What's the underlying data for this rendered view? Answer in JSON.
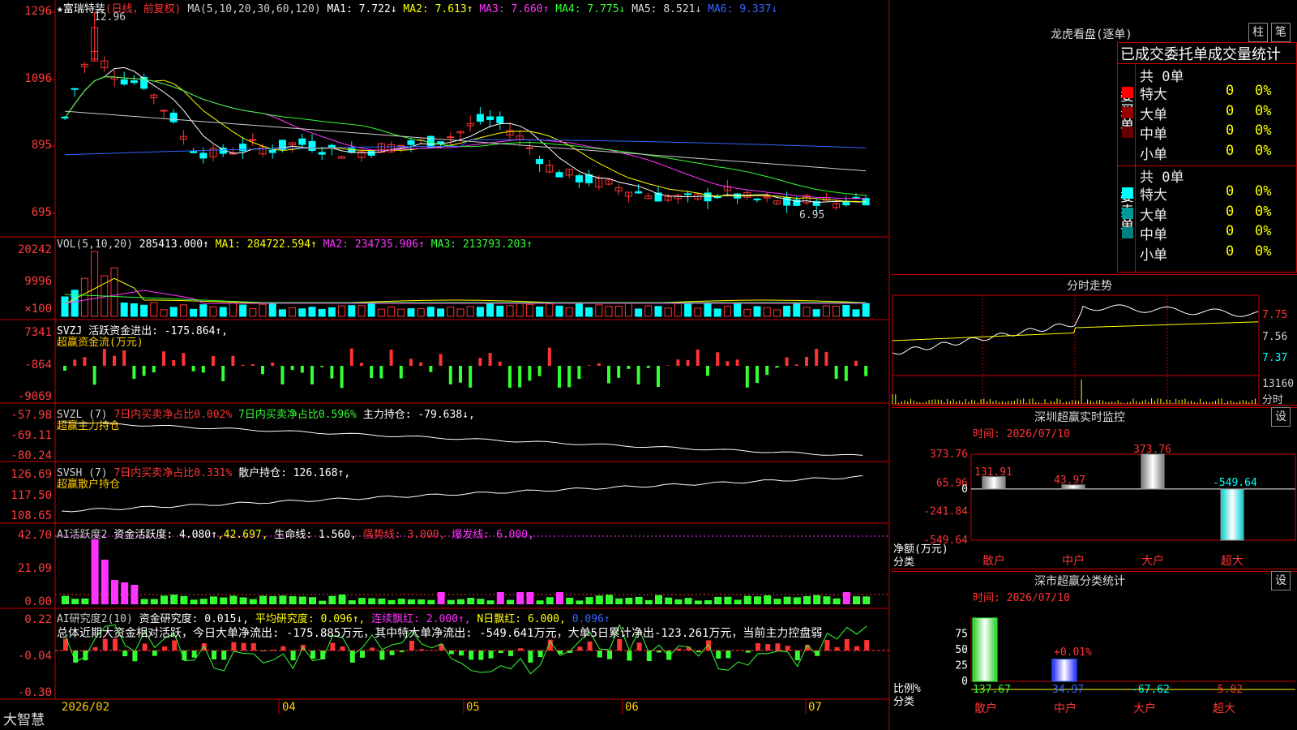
{
  "stock": {
    "name": "★富瑞特装",
    "mode": "(日线，前复权)"
  },
  "ma_legend": [
    {
      "t": "MA(5,10,20,30,60,120)",
      "c": "#cfcfcf"
    },
    {
      "t": " MA1: 7.722↓",
      "c": "#ffffff"
    },
    {
      "t": " MA2: 7.613↑",
      "c": "#ffff00"
    },
    {
      "t": " MA3: 7.660↑",
      "c": "#ff33ff"
    },
    {
      "t": " MA4: 7.775↓",
      "c": "#33ff33"
    },
    {
      "t": " MA5: 8.521↓",
      "c": "#dddddd"
    },
    {
      "t": " MA6: 9.337↓",
      "c": "#3366ff"
    }
  ],
  "price_axis": [
    "1296",
    "1096",
    "895",
    "695"
  ],
  "price_high_label": "12.96",
  "price_low_label": "6.95",
  "vol_legend": [
    {
      "t": "VOL(5,10,20)",
      "c": "#cfcfcf"
    },
    {
      "t": " 285413.000↑",
      "c": "#ffffff"
    },
    {
      "t": " MA1: 284722.594↑",
      "c": "#ffff00"
    },
    {
      "t": " MA2: 234735.906↑",
      "c": "#ff33ff"
    },
    {
      "t": " MA3: 213793.203↑",
      "c": "#33ff33"
    }
  ],
  "vol_axis": [
    "20242",
    "9996",
    "×100"
  ],
  "svzj_legend": [
    {
      "t": "SVZJ  活跃资金进出: -175.864↑,",
      "c": "#ffffff"
    }
  ],
  "svzj_sub": "超赢资金流(万元)",
  "svzj_axis": [
    "7341",
    "-864",
    "-9069"
  ],
  "svzl_legend": [
    {
      "t": "SVZL (7) ",
      "c": "#cfcfcf"
    },
    {
      "t": "7日内买卖净占比0.002%",
      "c": "#ff3333"
    },
    {
      "t": " 7日内买卖净占比0.596%",
      "c": "#33ff33"
    },
    {
      "t": " 主力持仓: -79.638↓,",
      "c": "#ffffff"
    }
  ],
  "svzl_sub": "超赢主力持仓",
  "svzl_axis": [
    "-57.98",
    "-69.11",
    "-80.24"
  ],
  "svsh_legend": [
    {
      "t": "SVSH (7) ",
      "c": "#cfcfcf"
    },
    {
      "t": "7日内买卖净占比0.331%",
      "c": "#ff3333"
    },
    {
      "t": " 散户持仓: 126.168↑,",
      "c": "#ffffff"
    }
  ],
  "svsh_sub": "超赢散户持仓",
  "svsh_axis": [
    "126.69",
    "117.50",
    "108.65"
  ],
  "ai_legend": [
    {
      "t": "AI活跃度2 ",
      "c": "#cfcfcf"
    },
    {
      "t": "资金活跃度: 4.080↑",
      "c": "#ffffff"
    },
    {
      "t": ",42.697,",
      "c": "#ffff00"
    },
    {
      "t": " 生命线: 1.560,",
      "c": "#ffffff"
    },
    {
      "t": " 强势线: 3.000,",
      "c": "#ff3333"
    },
    {
      "t": " 爆发线: 6.000,",
      "c": "#ff33ff"
    }
  ],
  "ai_axis": [
    "42.70",
    "21.09",
    "0.00"
  ],
  "air_legend": [
    {
      "t": "AI研究度2(10) ",
      "c": "#cfcfcf"
    },
    {
      "t": "资金研究度: 0.015↓,",
      "c": "#ffffff"
    },
    {
      "t": " 平均研究度: 0.096↑,",
      "c": "#ffff00"
    },
    {
      "t": " 连续飘红: 2.000↑,",
      "c": "#ff33ff"
    },
    {
      "t": " N日飘红: 6.000,",
      "c": "#ffff00"
    },
    {
      "t": " 0.096↑",
      "c": "#3366ff"
    }
  ],
  "air_text": "总体近期大资金相对活跃，今日大单净流出: -175.885万元，其中特大单净流出: -549.641万元，大单5日累计净出-123.261万元，当前主力控盘弱",
  "air_axis": [
    "0.22",
    "-0.04",
    "-0.30"
  ],
  "x_labels": [
    "2026/02",
    "04",
    "05",
    "06",
    "07"
  ],
  "bottom_tab": "大智慧",
  "lhb": {
    "title": "龙虎看盘(逐单)",
    "btn1": "柱",
    "btn2": "笔",
    "header": "已成交委托单成交量统计",
    "buy_label": "委买单",
    "sell_label": "委卖单",
    "buy_total": "共 0单",
    "sell_total": "共 0单",
    "buy_rows": [
      {
        "name": "特大",
        "v": "0",
        "p": "0%",
        "c": "#ff0000"
      },
      {
        "name": "大单",
        "v": "0",
        "p": "0%",
        "c": "#990000"
      },
      {
        "name": "中单",
        "v": "0",
        "p": "0%",
        "c": "#660000"
      },
      {
        "name": "小单",
        "v": "0",
        "p": "0%",
        "c": ""
      }
    ],
    "sell_rows": [
      {
        "name": "特大",
        "v": "0",
        "p": "0%",
        "c": "#00ffff"
      },
      {
        "name": "大单",
        "v": "0",
        "p": "0%",
        "c": "#009999"
      },
      {
        "name": "中单",
        "v": "0",
        "p": "0%",
        "c": "#008080"
      },
      {
        "name": "小单",
        "v": "0",
        "p": "0%",
        "c": ""
      }
    ]
  },
  "fs": {
    "title": "分时走势",
    "axis": [
      "7.75",
      "7.56",
      "7.37"
    ],
    "vol": "13160",
    "vol_unit": "分时"
  },
  "sz": {
    "title": "深圳超赢实时监控",
    "set": "设",
    "time": "时间: 2026/07/10",
    "axis": [
      "373.76",
      "65.96",
      "0",
      "-241.84",
      "-549.64"
    ],
    "ylabel": "净额(万元)",
    "xlabel": "分类",
    "cats": [
      "散户",
      "中户",
      "大户",
      "超大"
    ],
    "values": [
      131.91,
      43.97,
      373.76,
      -549.64
    ],
    "value_labels": [
      "131.91",
      "43.97",
      "373.76",
      "-549.64"
    ]
  },
  "ss": {
    "title": "深市超赢分类统计",
    "set": "设",
    "time": "时间: 2026/07/10",
    "axis": [
      "75",
      "50",
      "25",
      "0"
    ],
    "ylabel": "比例%",
    "xlabel": "分类",
    "cats": [
      "散户",
      "中户",
      "大户",
      "超大"
    ],
    "values": [
      137.67,
      34.97,
      -67.62,
      -5.02
    ],
    "value_labels": [
      "137.67",
      "34.97",
      "-67.62",
      "-5.02"
    ],
    "extra_label": "+0.01%"
  }
}
